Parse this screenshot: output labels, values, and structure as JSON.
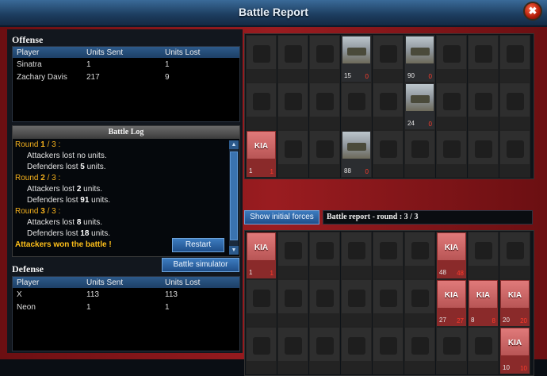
{
  "window": {
    "title": "Battle Report",
    "close_glyph": "✖"
  },
  "offense": {
    "title": "Offense",
    "columns": [
      "Player",
      "Units Sent",
      "Units Lost"
    ],
    "rows": [
      [
        "Sinatra",
        "1",
        "1"
      ],
      [
        "Zachary Davis",
        "217",
        "9"
      ]
    ]
  },
  "battle_log": {
    "title": "Battle Log",
    "rounds": [
      {
        "label": "Round ",
        "num": "1",
        "total": " / 3",
        "suffix": " :",
        "attackers": [
          "Attackers lost ",
          "no",
          " units."
        ],
        "defenders": [
          "Defenders lost ",
          "5",
          " units."
        ]
      },
      {
        "label": "Round ",
        "num": "2",
        "total": " / 3",
        "suffix": " :",
        "attackers": [
          "Attackers lost ",
          "2",
          " units."
        ],
        "defenders": [
          "Defenders lost ",
          "91",
          " units."
        ]
      },
      {
        "label": "Round ",
        "num": "3",
        "total": " / 3",
        "suffix": " :",
        "attackers": [
          "Attackers lost ",
          "8",
          " units."
        ],
        "defenders": [
          "Defenders lost ",
          "18",
          " units."
        ]
      }
    ],
    "result": "Attackers won the battle !"
  },
  "buttons": {
    "restart": "Restart",
    "battle_simulator": "Battle simulator",
    "show_initial_forces": "Show initial forces"
  },
  "defense": {
    "title": "Defense",
    "columns": [
      "Player",
      "Units Sent",
      "Units Lost"
    ],
    "rows": [
      [
        "X",
        "113",
        "113"
      ],
      [
        "Neon",
        "1",
        "1"
      ]
    ]
  },
  "report_label": "Battle report - round : 3 / 3",
  "top_grid": [
    {
      "row": 0,
      "col": 3,
      "state": "active",
      "count": "15",
      "lost": "0",
      "icon": "jeep-unit-icon"
    },
    {
      "row": 0,
      "col": 5,
      "state": "active",
      "count": "90",
      "lost": "0",
      "icon": "rocket-truck-unit-icon"
    },
    {
      "row": 1,
      "col": 5,
      "state": "active",
      "count": "24",
      "lost": "0",
      "icon": "armored-vehicle-unit-icon"
    },
    {
      "row": 2,
      "col": 0,
      "state": "kia",
      "kia": "KIA",
      "count": "1",
      "lost": "1",
      "icon": "soldier-unit-icon"
    },
    {
      "row": 2,
      "col": 3,
      "state": "active",
      "count": "88",
      "lost": "0",
      "icon": "humvee-unit-icon"
    }
  ],
  "bottom_grid": [
    {
      "row": 0,
      "col": 0,
      "state": "kia",
      "kia": "KIA",
      "count": "1",
      "lost": "1",
      "icon": "soldier-unit-icon"
    },
    {
      "row": 0,
      "col": 6,
      "state": "kia",
      "kia": "KIA",
      "count": "48",
      "lost": "48",
      "icon": "tank-unit-icon"
    },
    {
      "row": 1,
      "col": 6,
      "state": "kia",
      "kia": "KIA",
      "count": "27",
      "lost": "27",
      "icon": "tank-unit-icon"
    },
    {
      "row": 1,
      "col": 7,
      "state": "kia",
      "kia": "KIA",
      "count": "8",
      "lost": "8",
      "icon": "tank-unit-icon"
    },
    {
      "row": 1,
      "col": 8,
      "state": "kia",
      "kia": "KIA",
      "count": "20",
      "lost": "20",
      "icon": "tank-unit-icon"
    },
    {
      "row": 2,
      "col": 8,
      "state": "kia",
      "kia": "KIA",
      "count": "10",
      "lost": "10",
      "icon": "tank-unit-icon"
    }
  ]
}
